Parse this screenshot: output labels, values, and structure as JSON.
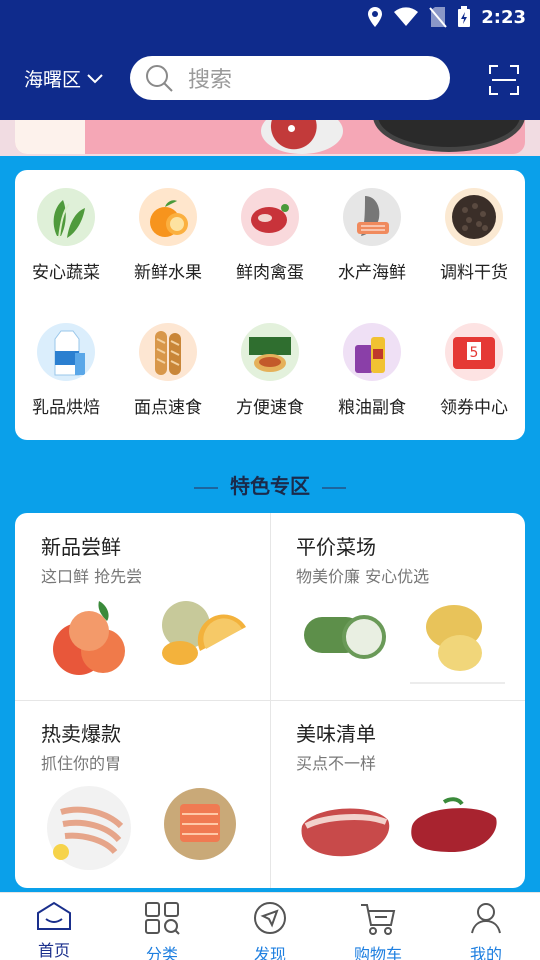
{
  "status": {
    "time": "2:23"
  },
  "header": {
    "district": "海曙区",
    "search_placeholder": "搜索"
  },
  "categories": [
    {
      "label": "安心蔬菜",
      "icon": "vegetable-icon",
      "color": "#dff0d8"
    },
    {
      "label": "新鲜水果",
      "icon": "fruit-icon",
      "color": "#ffe6cc"
    },
    {
      "label": "鲜肉禽蛋",
      "icon": "meat-icon",
      "color": "#f9d9dc"
    },
    {
      "label": "水产海鲜",
      "icon": "seafood-icon",
      "color": "#e6e6e6"
    },
    {
      "label": "调料干货",
      "icon": "spice-icon",
      "color": "#fbe9d2"
    },
    {
      "label": "乳品烘焙",
      "icon": "dairy-icon",
      "color": "#dbeefc"
    },
    {
      "label": "面点速食",
      "icon": "bread-icon",
      "color": "#fde6d2"
    },
    {
      "label": "方便速食",
      "icon": "instant-food-icon",
      "color": "#e3f1dc"
    },
    {
      "label": "粮油副食",
      "icon": "oil-icon",
      "color": "#efe0f5"
    },
    {
      "label": "领券中心",
      "icon": "coupon-icon",
      "color": "#fde3e3"
    }
  ],
  "section": {
    "title": "特色专区"
  },
  "features": [
    {
      "title": "新品尝鲜",
      "subtitle": "这口鲜 抢先尝"
    },
    {
      "title": "平价菜场",
      "subtitle": "物美价廉 安心优选"
    },
    {
      "title": "热卖爆款",
      "subtitle": "抓住你的胃"
    },
    {
      "title": "美味清单",
      "subtitle": "买点不一样"
    }
  ],
  "tabs": [
    {
      "label": "首页",
      "icon": "home-icon",
      "active": true
    },
    {
      "label": "分类",
      "icon": "category-icon",
      "active": false
    },
    {
      "label": "发现",
      "icon": "discover-icon",
      "active": false
    },
    {
      "label": "购物车",
      "icon": "cart-icon",
      "active": false
    },
    {
      "label": "我的",
      "icon": "profile-icon",
      "active": false
    }
  ],
  "colors": {
    "header": "#0f2b8c",
    "background_blue": "#0aa0ea",
    "tab_active": "#1a2f8c",
    "tab_inactive": "#1e7fe0"
  }
}
